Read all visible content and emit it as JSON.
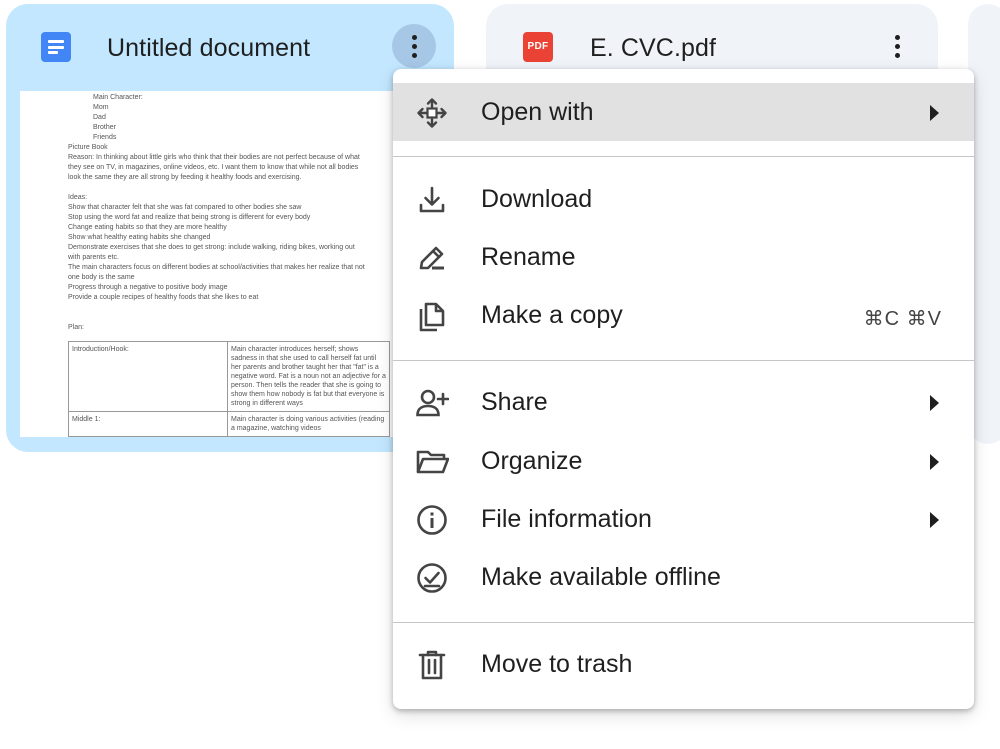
{
  "files": [
    {
      "title": "Untitled document",
      "icon": "google-docs-icon",
      "selected": true,
      "preview": {
        "characters_lines": [
          "Main Character:",
          "Mom",
          "Dad",
          "Brother",
          "Friends"
        ],
        "body_lines": [
          "Picture Book",
          "Reason: In thinking about little girls who think that their bodies are not perfect because of what",
          "they see on TV, in magazines, online videos, etc. I want them to know that while not all bodies",
          "look the same they are all strong by feeding it healthy foods and exercising.",
          "",
          "Ideas:",
          "Show that character felt that she was fat compared to other bodies she saw",
          "Stop using the word fat and realize that being strong is different for every body",
          "Change eating habits so that they are more healthy",
          "Show what healthy eating habits she changed",
          "Demonstrate exercises that she does to get strong: include walking, riding bikes, working out",
          "with parents etc.",
          "The main characters focus on different bodies at school/activities that makes her realize that not",
          "one body is the same",
          "Progress through a negative to positive body image",
          "Provide a couple recipes of healthy foods that she likes to eat",
          "",
          "",
          "Plan:"
        ],
        "table": [
          [
            "Introduction/Hook:",
            "Main character introduces herself; shows sadness in that she used to call herself fat until her parents and brother taught her that \"fat\" is a negative word. Fat is a noun not an adjective for a person. Then tells the reader that she is going to show them how nobody is fat but that everyone is strong in different ways"
          ],
          [
            "Middle 1:",
            "Main character is doing various activities (reading a magazine, watching videos"
          ]
        ]
      }
    },
    {
      "title": "E. CVC.pdf",
      "icon": "pdf-icon",
      "icon_text": "PDF",
      "selected": false
    }
  ],
  "context_menu": {
    "items": [
      {
        "id": "open-with",
        "label": "Open with",
        "icon": "open-with-icon",
        "submenu": true,
        "highlighted": true
      },
      {
        "id": "download",
        "label": "Download",
        "icon": "download-icon"
      },
      {
        "id": "rename",
        "label": "Rename",
        "icon": "rename-pencil-icon"
      },
      {
        "id": "make-a-copy",
        "label": "Make a copy",
        "icon": "copy-icon",
        "shortcut": "⌘C ⌘V"
      },
      {
        "id": "share",
        "label": "Share",
        "icon": "share-person-add-icon",
        "submenu": true
      },
      {
        "id": "organize",
        "label": "Organize",
        "icon": "folder-open-icon",
        "submenu": true
      },
      {
        "id": "file-information",
        "label": "File information",
        "icon": "info-icon",
        "submenu": true
      },
      {
        "id": "make-available-offline",
        "label": "Make available offline",
        "icon": "offline-check-icon"
      },
      {
        "id": "move-to-trash",
        "label": "Move to trash",
        "icon": "trash-icon"
      }
    ]
  },
  "colors": {
    "selected_card": "#c2e7ff",
    "card": "#f0f4f9",
    "menu_highlight": "#e1e1e1",
    "docs_blue": "#4285f4",
    "pdf_red": "#ea4335"
  }
}
